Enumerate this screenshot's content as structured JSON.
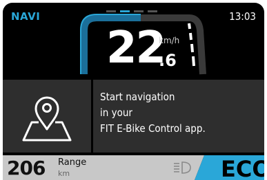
{
  "top_bar": {
    "mode": "NAVI",
    "time": "13:03",
    "pages": [
      false,
      true,
      false,
      false
    ]
  },
  "speed": {
    "integer": "22",
    "decimal": ".6",
    "unit": "km/h"
  },
  "navigation": {
    "message_lines": [
      "Start navigation",
      "in your",
      "FIT E-Bike Control app."
    ]
  },
  "status": {
    "range_value": "206",
    "range_label": "Range",
    "range_unit": "km",
    "assist_mode": "ECO"
  },
  "colors": {
    "accent": "#2aa7d8",
    "panel": "#2e2e2e",
    "range_bg": "#c8c8c8"
  },
  "icons": {
    "map": "map-pin-icon",
    "light": "headlight-icon"
  }
}
